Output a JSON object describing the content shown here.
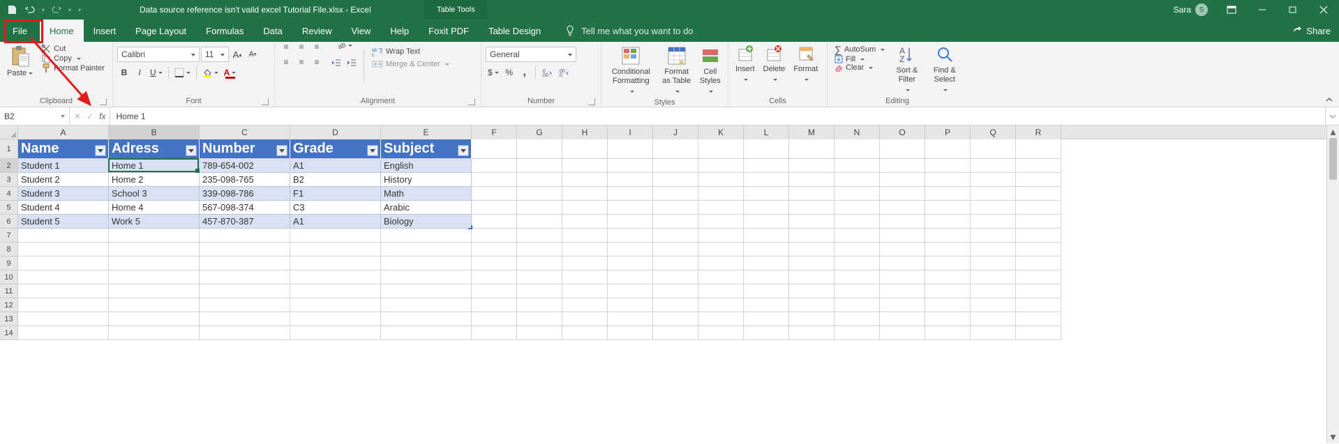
{
  "title": "Data source reference isn't vaild excel Tutorial File.xlsx  -  Excel",
  "table_tools": "Table Tools",
  "user": {
    "name": "Sara",
    "initial": "S"
  },
  "tabs": {
    "file": "File",
    "home": "Home",
    "insert": "Insert",
    "page_layout": "Page Layout",
    "formulas": "Formulas",
    "data": "Data",
    "review": "Review",
    "view": "View",
    "help": "Help",
    "foxit": "Foxit PDF",
    "table_design": "Table Design",
    "tellme": "Tell me what you want to do",
    "share": "Share"
  },
  "ribbon": {
    "clipboard": {
      "paste": "Paste",
      "cut": "Cut",
      "copy": "Copy",
      "format_painter": "Format Painter",
      "label": "Clipboard"
    },
    "font": {
      "name": "Calibri",
      "size": "11",
      "label": "Font"
    },
    "alignment": {
      "wrap": "Wrap Text",
      "merge": "Merge & Center",
      "label": "Alignment"
    },
    "number": {
      "format": "General",
      "label": "Number"
    },
    "styles": {
      "cond": "Conditional Formatting",
      "fat": "Format as Table",
      "cell": "Cell Styles",
      "label": "Styles"
    },
    "cells": {
      "insert": "Insert",
      "delete": "Delete",
      "format": "Format",
      "label": "Cells"
    },
    "editing": {
      "autosum": "AutoSum",
      "fill": "Fill",
      "clear": "Clear",
      "sort": "Sort & Filter",
      "find": "Find & Select",
      "label": "Editing"
    }
  },
  "namebox": "B2",
  "formula": "Home 1",
  "cols": [
    "A",
    "B",
    "C",
    "D",
    "E",
    "F",
    "G",
    "H",
    "I",
    "J",
    "K",
    "L",
    "M",
    "N",
    "O",
    "P",
    "Q",
    "R"
  ],
  "col_widths": {
    "A": 130,
    "B": 130,
    "C": 130,
    "D": 130,
    "E": 130,
    "rest": 65
  },
  "table": {
    "headers": [
      "Name",
      "Adress",
      "Number",
      "Grade",
      "Subject"
    ],
    "rows": [
      [
        "Student 1",
        "Home 1",
        "789-654-002",
        "A1",
        "English"
      ],
      [
        "Student 2",
        "Home 2",
        "235-098-765",
        "B2",
        "History"
      ],
      [
        "Student 3",
        "School 3",
        "339-098-786",
        "F1",
        "Math"
      ],
      [
        "Student 4",
        "Home 4",
        "567-098-374",
        "C3",
        "Arabic"
      ],
      [
        "Student 5",
        "Work 5",
        "457-870-387",
        "A1",
        "Biology"
      ]
    ]
  },
  "active_cell": {
    "row": 2,
    "col": "B"
  },
  "row_count": 14
}
